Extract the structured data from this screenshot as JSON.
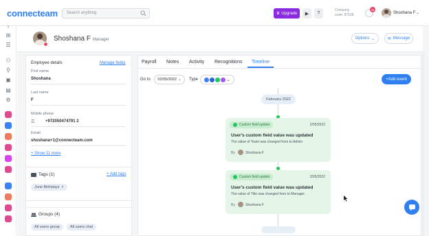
{
  "app": {
    "logo": "connecteam"
  },
  "topbar": {
    "search_placeholder": "Search anything",
    "upgrade_label": "Upgrade",
    "play_label": "▶",
    "help_label": "?",
    "company_label": "Company",
    "company_code": "code: 87528",
    "notification_count": "25",
    "user_name": "Shoshana F"
  },
  "profile": {
    "name": "Shoshana F",
    "role": "Manager",
    "options_label": "Options",
    "message_label": "Message"
  },
  "details": {
    "title": "Employee details",
    "manage_fields": "Manage fields",
    "first_name_label": "First name",
    "first_name_value": "Shoshana",
    "last_name_label": "Last name",
    "last_name_value": "F",
    "mobile_label": "Mobile phone",
    "mobile_country": "☰",
    "mobile_value": "+972050474791 2",
    "email_label": "Email",
    "email_value": "shoshana+1@connecteam.com",
    "show_more": "+ Show 11 more"
  },
  "tags": {
    "title": "Tags (1)",
    "add_label": "+ Add tags",
    "items": [
      "June Birthdays"
    ]
  },
  "groups": {
    "title": "Groups (4)",
    "items": [
      "All users group",
      "All users chat"
    ]
  },
  "tabs": [
    "Payroll",
    "Notes",
    "Activity",
    "Recognitions",
    "Timeline"
  ],
  "active_tab": "Timeline",
  "filters": {
    "goto_label": "Go to",
    "date_value": "02/05/2022",
    "type_label": "Type"
  },
  "add_event_label": "+Add event",
  "timeline": {
    "month": "February 2022",
    "events": [
      {
        "tag": "Custom field update",
        "date": "2/05/2022",
        "heading": "User's custom field value was updated",
        "detail": "The value of Team was changed from to Admin",
        "by_label": "By",
        "by_name": "Shoshana F"
      },
      {
        "tag": "Custom field update",
        "date": "2/05/2022",
        "heading": "User's custom field value was updated",
        "detail": "The value of Title was changed from to Manager",
        "by_label": "By",
        "by_name": "Shoshana F"
      }
    ]
  },
  "colors": {
    "brand": "#2f7ff0",
    "upgrade": "#8a2be2",
    "event_green": "#22c55e",
    "card_bg": "#e5f6e8"
  }
}
